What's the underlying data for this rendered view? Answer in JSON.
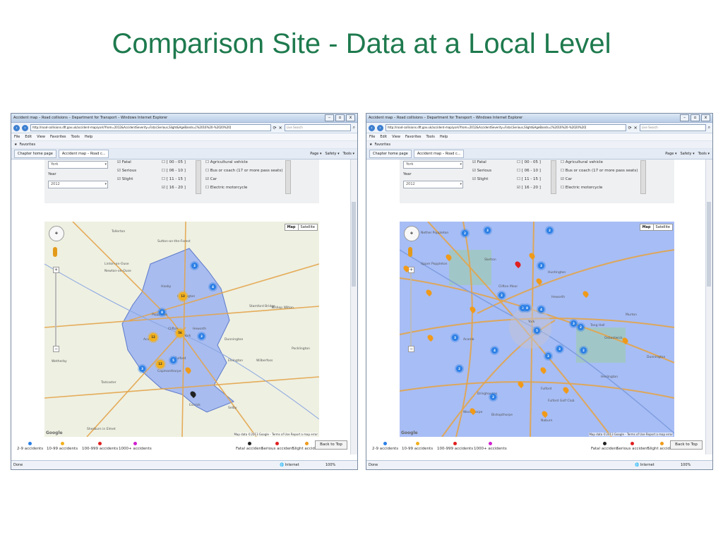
{
  "slide": {
    "title": "Comparison Site - Data at a Local Level"
  },
  "browser": {
    "title": "Accident map – Road collisions – Department for Transport – Windows Internet Explorer",
    "url": "http://road-collisions.dft.gov.uk/accident-map/york?from=2012&AccidentSeverity=Fatal,Serious,Slight&AgeBands=[%2016%20-%2020%20]",
    "search_placeholder": "Live Search",
    "menu": [
      "File",
      "Edit",
      "View",
      "Favorites",
      "Tools",
      "Help"
    ],
    "favorites_label": "Favorites",
    "tabs": [
      "Chapter home page",
      "Accident map – Road c..."
    ],
    "toolbar": [
      "Page ▾",
      "Safety ▾",
      "Tools ▾"
    ],
    "status_done": "Done",
    "status_zone": "Internet",
    "status_zoom": "100%"
  },
  "filters": {
    "location": "York",
    "year_label": "Year",
    "year": "2012",
    "severity": [
      "Fatal",
      "Serious",
      "Slight"
    ],
    "age_bands": [
      "[ 00 - 05 ]",
      "[ 06 - 10 ]",
      "[ 11 - 15 ]",
      "[ 16 - 20 ]"
    ],
    "vehicles": [
      "Agricultural vehicle",
      "Bus or coach (17 or more pass seats)",
      "Car",
      "Electric motorcycle"
    ]
  },
  "map": {
    "type_map": "Map",
    "type_satellite": "Satellite",
    "credit": "Map data ©2013 Google - Terms of Use  Report a map error",
    "google": "Google",
    "left_labels": [
      "Tollerton",
      "Sutton-on-the-Forest",
      "Linton-on-Ouse",
      "Newton-on-Ouse",
      "Haxby",
      "Huntington",
      "Poppleton",
      "Clifton",
      "Heworth",
      "York",
      "Acomb",
      "Dunnington",
      "Fulford",
      "Copmanthorpe",
      "Wetherby",
      "Tadcaster",
      "Elvington",
      "Wilberfoss",
      "Pocklington",
      "Selby",
      "Escrick",
      "Stamford Bridge",
      "Bishop Wilton",
      "Sherburn in Elmet"
    ],
    "right_labels": [
      "Nether Poppleton",
      "Upper Poppleton",
      "Skelton",
      "Clifton Moor",
      "Huntington",
      "Heworth",
      "York",
      "Acomb",
      "Tang Hall",
      "Osbaldwick",
      "Dringhouses",
      "Fulford",
      "Bishopthorpe",
      "Heslington",
      "Murton",
      "Dunnington",
      "Woodthorpe",
      "Naburn",
      "Fulford Golf Club"
    ],
    "left_clusters": [
      {
        "n": "3",
        "c": "blue"
      },
      {
        "n": "4",
        "c": "blue"
      },
      {
        "n": "8",
        "c": "blue"
      },
      {
        "n": "13",
        "c": "amber"
      },
      {
        "n": "12",
        "c": "amber"
      },
      {
        "n": "56",
        "c": "amber"
      },
      {
        "n": "3",
        "c": "blue"
      },
      {
        "n": "12",
        "c": "amber"
      },
      {
        "n": "5",
        "c": "blue"
      },
      {
        "n": "3",
        "c": "blue"
      }
    ],
    "right_clusters": [
      {
        "n": "2",
        "c": "blue"
      },
      {
        "n": "3",
        "c": "blue"
      },
      {
        "n": "2",
        "c": "blue"
      },
      {
        "n": "3",
        "c": "blue"
      },
      {
        "n": "2",
        "c": "blue"
      },
      {
        "n": "3",
        "c": "blue"
      },
      {
        "n": "8",
        "c": "blue"
      },
      {
        "n": "4",
        "c": "blue"
      },
      {
        "n": "3",
        "c": "blue"
      },
      {
        "n": "2",
        "c": "blue"
      },
      {
        "n": "5",
        "c": "blue"
      },
      {
        "n": "3",
        "c": "blue"
      },
      {
        "n": "4",
        "c": "blue"
      },
      {
        "n": "2",
        "c": "blue"
      },
      {
        "n": "3",
        "c": "blue"
      },
      {
        "n": "2",
        "c": "blue"
      },
      {
        "n": "2",
        "c": "blue"
      },
      {
        "n": "2",
        "c": "blue"
      }
    ]
  },
  "legend": {
    "clusters": [
      {
        "label": "2-9 accidents",
        "color": "#2a7fe6"
      },
      {
        "label": "10-99 accidents",
        "color": "#f2b01e"
      },
      {
        "label": "100-999 accidents",
        "color": "#e02020"
      },
      {
        "label": "1000+ accidents",
        "color": "#d020d0"
      }
    ],
    "pins": [
      {
        "label": "Fatal accident",
        "color": "#222222"
      },
      {
        "label": "Serious accident",
        "color": "#e02020"
      },
      {
        "label": "Slight accident",
        "color": "#f09a1a"
      }
    ],
    "back_to_top": "Back to Top"
  },
  "colors": {
    "title_green": "#1e7a4e",
    "boundary_fill": "#9bb3f2",
    "road_orange": "#e3a44a"
  }
}
